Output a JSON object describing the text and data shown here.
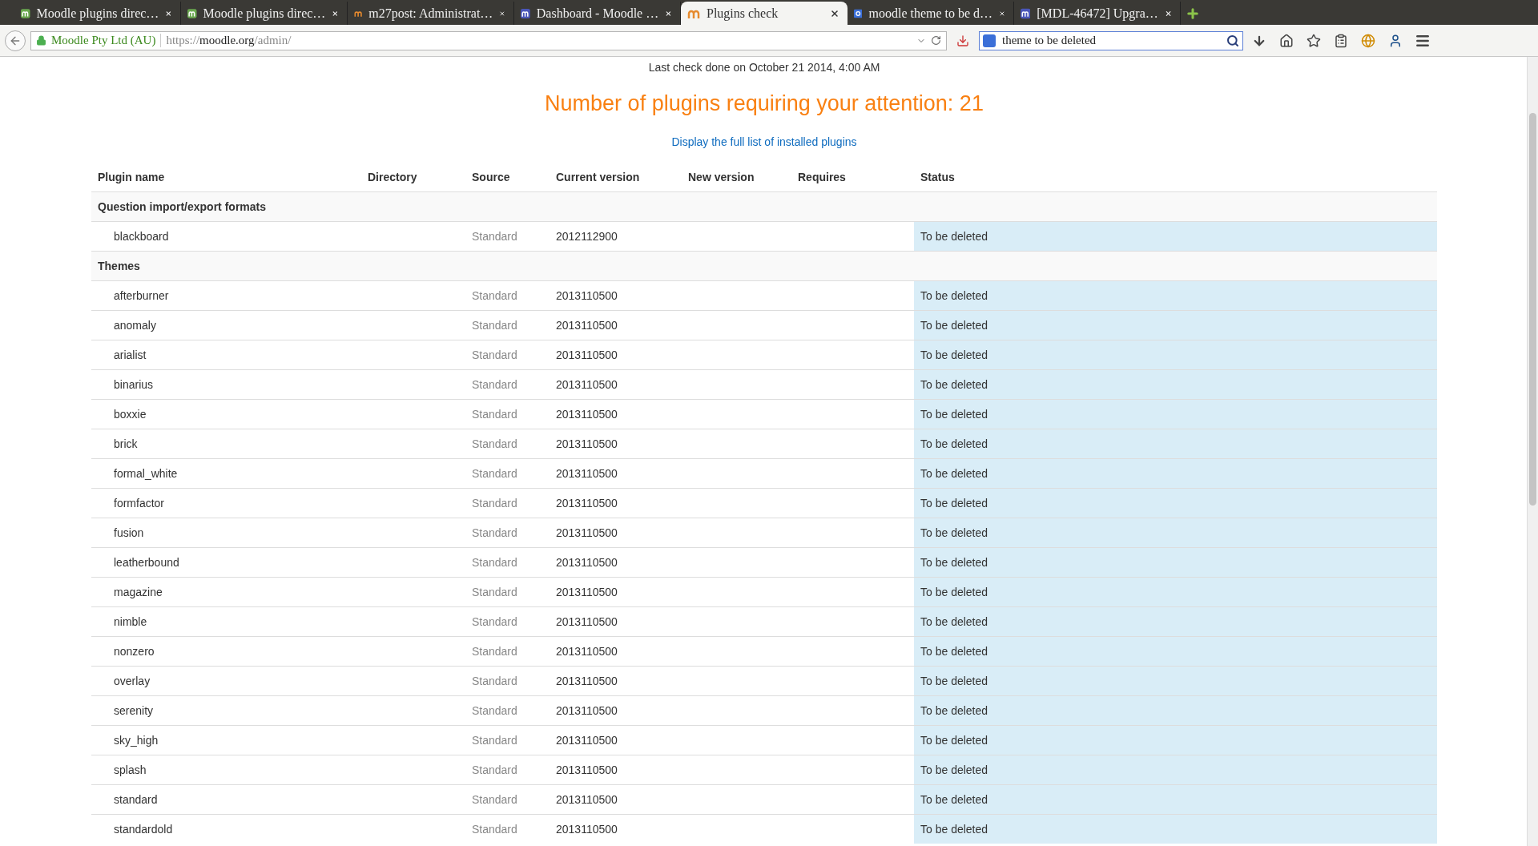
{
  "browser": {
    "tabs": [
      {
        "title": "Moodle plugins direc…",
        "kind": "moodle",
        "color": "#6aa84f",
        "selected": false
      },
      {
        "title": "Moodle plugins direc…",
        "kind": "moodle",
        "color": "#6aa84f",
        "selected": false
      },
      {
        "title": "m27post: Administrat…",
        "kind": "moodle-plain",
        "color": "#e68a2e",
        "selected": false
      },
      {
        "title": "Dashboard - Moodle …",
        "kind": "moodle",
        "color": "#4a56b8",
        "selected": false
      },
      {
        "title": "Plugins check",
        "kind": "moodle-plain",
        "color": "#e68a2e",
        "selected": true
      },
      {
        "title": "moodle theme to be d…",
        "kind": "google",
        "color": "#3b6fd8",
        "selected": false
      },
      {
        "title": "[MDL-46472] Upgra…",
        "kind": "moodle",
        "color": "#4a56b8",
        "selected": false
      }
    ],
    "identity": "Moodle Pty Ltd (AU)",
    "url": {
      "scheme": "https://",
      "host": "moodle.org",
      "path": "/admin/"
    },
    "search": {
      "value": "theme to be deleted"
    }
  },
  "page": {
    "last_check": "Last check done on October 21 2014, 4:00 AM",
    "heading": "Number of plugins requiring your attention: 21",
    "link": "Display the full list of installed plugins",
    "table": {
      "columns": [
        "Plugin name",
        "Directory",
        "Source",
        "Current version",
        "New version",
        "Requires",
        "Status"
      ],
      "groups": [
        {
          "name": "Question import/export formats",
          "rows": [
            {
              "name": "blackboard",
              "source": "Standard",
              "current_version": "2012112900",
              "status": "To be deleted"
            }
          ]
        },
        {
          "name": "Themes",
          "rows": [
            {
              "name": "afterburner",
              "source": "Standard",
              "current_version": "2013110500",
              "status": "To be deleted"
            },
            {
              "name": "anomaly",
              "source": "Standard",
              "current_version": "2013110500",
              "status": "To be deleted"
            },
            {
              "name": "arialist",
              "source": "Standard",
              "current_version": "2013110500",
              "status": "To be deleted"
            },
            {
              "name": "binarius",
              "source": "Standard",
              "current_version": "2013110500",
              "status": "To be deleted"
            },
            {
              "name": "boxxie",
              "source": "Standard",
              "current_version": "2013110500",
              "status": "To be deleted"
            },
            {
              "name": "brick",
              "source": "Standard",
              "current_version": "2013110500",
              "status": "To be deleted"
            },
            {
              "name": "formal_white",
              "source": "Standard",
              "current_version": "2013110500",
              "status": "To be deleted"
            },
            {
              "name": "formfactor",
              "source": "Standard",
              "current_version": "2013110500",
              "status": "To be deleted"
            },
            {
              "name": "fusion",
              "source": "Standard",
              "current_version": "2013110500",
              "status": "To be deleted"
            },
            {
              "name": "leatherbound",
              "source": "Standard",
              "current_version": "2013110500",
              "status": "To be deleted"
            },
            {
              "name": "magazine",
              "source": "Standard",
              "current_version": "2013110500",
              "status": "To be deleted"
            },
            {
              "name": "nimble",
              "source": "Standard",
              "current_version": "2013110500",
              "status": "To be deleted"
            },
            {
              "name": "nonzero",
              "source": "Standard",
              "current_version": "2013110500",
              "status": "To be deleted"
            },
            {
              "name": "overlay",
              "source": "Standard",
              "current_version": "2013110500",
              "status": "To be deleted"
            },
            {
              "name": "serenity",
              "source": "Standard",
              "current_version": "2013110500",
              "status": "To be deleted"
            },
            {
              "name": "sky_high",
              "source": "Standard",
              "current_version": "2013110500",
              "status": "To be deleted"
            },
            {
              "name": "splash",
              "source": "Standard",
              "current_version": "2013110500",
              "status": "To be deleted"
            },
            {
              "name": "standard",
              "source": "Standard",
              "current_version": "2013110500",
              "status": "To be deleted"
            },
            {
              "name": "standardold",
              "source": "Standard",
              "current_version": "2013110500",
              "status": "To be deleted"
            }
          ]
        }
      ]
    }
  }
}
